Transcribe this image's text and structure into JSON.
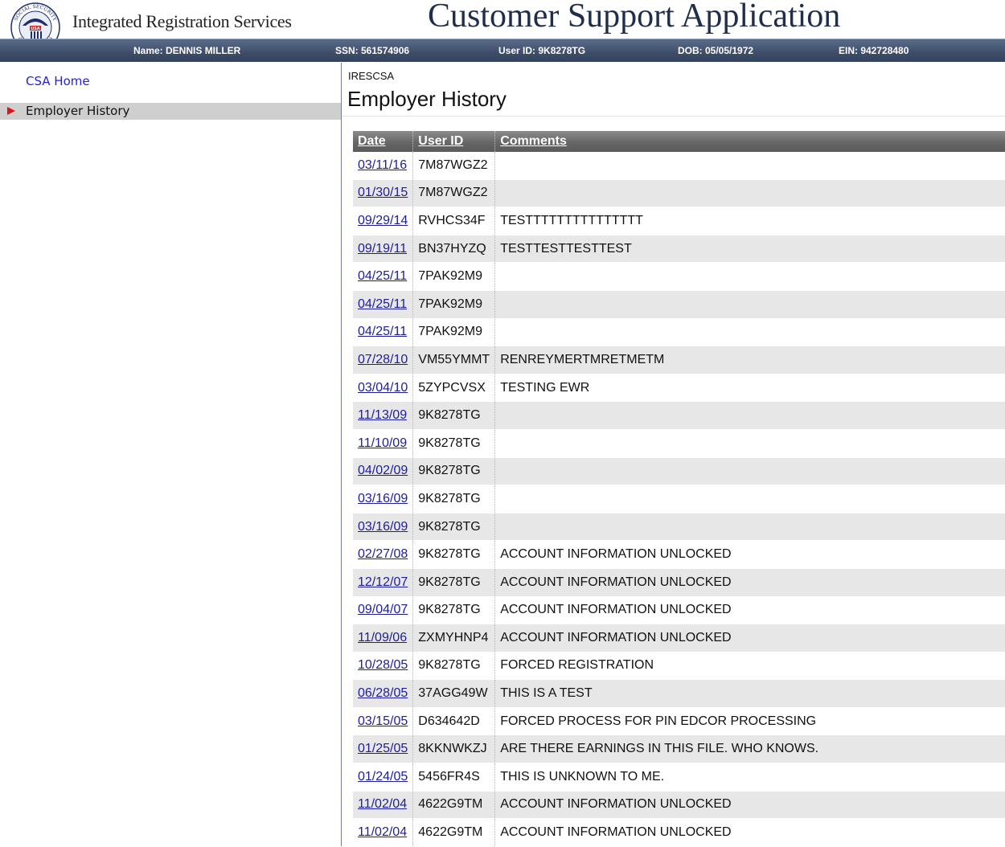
{
  "header": {
    "agency_name": "Integrated Registration Services",
    "app_title": "Customer Support Application",
    "seal_text_top": "SOCIAL SECURITY",
    "seal_text_mid": "USA",
    "seal_text_bottom": "ADMINISTRATION"
  },
  "info_bar": {
    "name": "Name: DENNIS MILLER",
    "ssn": "SSN: 561574906",
    "user_id": "User ID: 9K8278TG",
    "dob": "DOB: 05/05/1972",
    "ein": "EIN: 942728480"
  },
  "sidebar": {
    "home_label": "CSA Home",
    "active_label": "Employer History"
  },
  "page": {
    "code": "IRESCSA",
    "title": "Employer History"
  },
  "table": {
    "headers": [
      "Date",
      "User ID",
      "Comments"
    ],
    "rows": [
      {
        "date": "03/11/16",
        "user_id": "7M87WGZ2",
        "comments": ""
      },
      {
        "date": "01/30/15",
        "user_id": "7M87WGZ2",
        "comments": ""
      },
      {
        "date": "09/29/14",
        "user_id": "RVHCS34F",
        "comments": "TESTTTTTTTTTTTTTTT"
      },
      {
        "date": "09/19/11",
        "user_id": "BN37HYZQ",
        "comments": "TESTTESTTESTTEST"
      },
      {
        "date": "04/25/11",
        "user_id": "7PAK92M9",
        "comments": ""
      },
      {
        "date": "04/25/11",
        "user_id": "7PAK92M9",
        "comments": ""
      },
      {
        "date": "04/25/11",
        "user_id": "7PAK92M9",
        "comments": ""
      },
      {
        "date": "07/28/10",
        "user_id": "VM55YMMT",
        "comments": "RENREYMERTMRETMETM"
      },
      {
        "date": "03/04/10",
        "user_id": "5ZYPCVSX",
        "comments": "TESTING EWR"
      },
      {
        "date": "11/13/09",
        "user_id": "9K8278TG",
        "comments": ""
      },
      {
        "date": "11/10/09",
        "user_id": "9K8278TG",
        "comments": ""
      },
      {
        "date": "04/02/09",
        "user_id": "9K8278TG",
        "comments": ""
      },
      {
        "date": "03/16/09",
        "user_id": "9K8278TG",
        "comments": ""
      },
      {
        "date": "03/16/09",
        "user_id": "9K8278TG",
        "comments": ""
      },
      {
        "date": "02/27/08",
        "user_id": "9K8278TG",
        "comments": "ACCOUNT INFORMATION UNLOCKED"
      },
      {
        "date": "12/12/07",
        "user_id": "9K8278TG",
        "comments": "ACCOUNT INFORMATION UNLOCKED"
      },
      {
        "date": "09/04/07",
        "user_id": "9K8278TG",
        "comments": "ACCOUNT INFORMATION UNLOCKED"
      },
      {
        "date": "11/09/06",
        "user_id": "ZXMYHNP4",
        "comments": "ACCOUNT INFORMATION UNLOCKED"
      },
      {
        "date": "10/28/05",
        "user_id": "9K8278TG",
        "comments": "FORCED REGISTRATION"
      },
      {
        "date": "06/28/05",
        "user_id": "37AGG49W",
        "comments": "THIS IS A TEST"
      },
      {
        "date": "03/15/05",
        "user_id": "D634642D",
        "comments": "FORCED PROCESS FOR PIN EDCOR PROCESSING"
      },
      {
        "date": "01/25/05",
        "user_id": "8KKNWKZJ",
        "comments": "ARE THERE EARNINGS IN THIS FILE. WHO KNOWS."
      },
      {
        "date": "01/24/05",
        "user_id": "5456FR4S",
        "comments": "THIS IS UNKNOWN TO ME."
      },
      {
        "date": "11/02/04",
        "user_id": "4622G9TM",
        "comments": "ACCOUNT INFORMATION UNLOCKED"
      },
      {
        "date": "11/02/04",
        "user_id": "4622G9TM",
        "comments": "ACCOUNT INFORMATION UNLOCKED"
      }
    ]
  },
  "colors": {
    "info_bar": "#3e4e6a",
    "nav_link": "#2424d6",
    "nav_active_bg": "#cfcfcf",
    "nav_arrow": "#e01414",
    "table_header": "#666666",
    "row_alt": "#e7e7e7",
    "date_link": "#1d1d9a"
  }
}
